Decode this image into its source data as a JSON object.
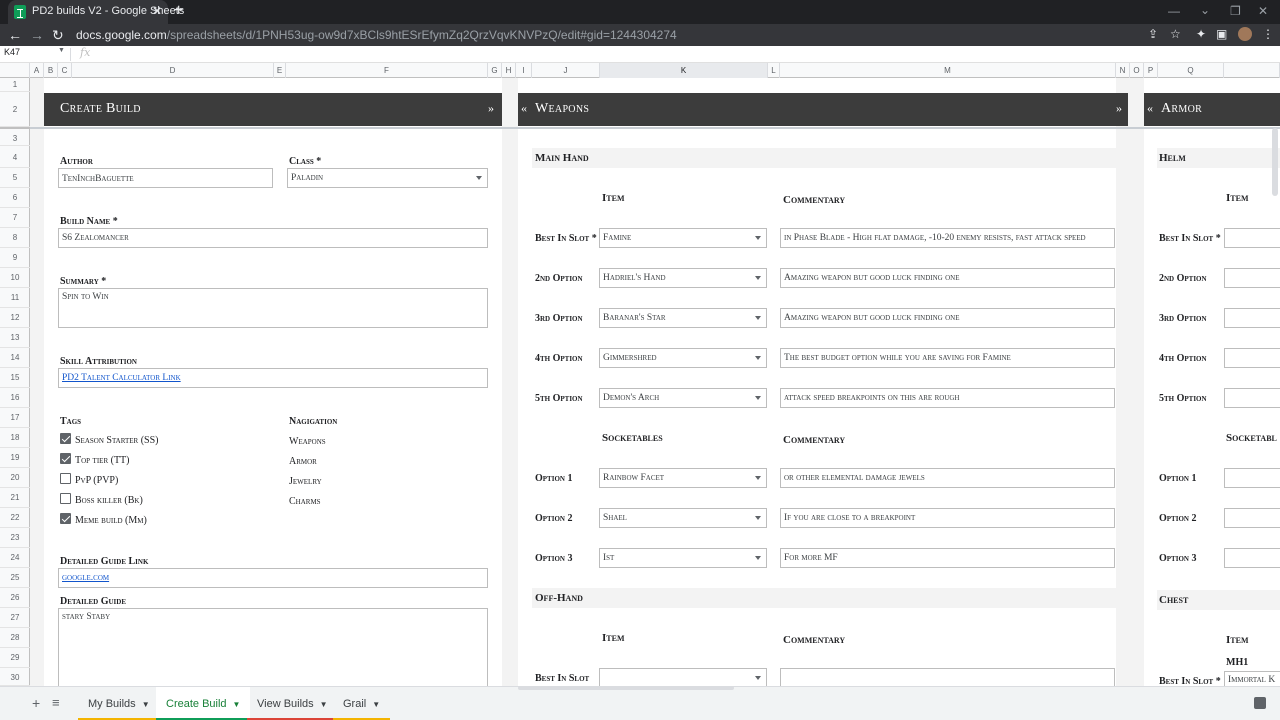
{
  "browser": {
    "tab_title": "PD2 builds V2 - Google Sheets",
    "url_host": "docs.google.com",
    "url_path": "/spreadsheets/d/1PNH53ug-ow9d7xBCls9htESrEfymZq2QrzVqvKNVPzQ/edit#gid=1244304274"
  },
  "sheet": {
    "cell_ref": "K47",
    "columns": [
      "A",
      "B",
      "C",
      "D",
      "E",
      "F",
      "G",
      "H",
      "I",
      "J",
      "K",
      "L",
      "M",
      "N",
      "O",
      "P",
      "Q"
    ],
    "rows": [
      "1",
      "2",
      "3",
      "4",
      "5",
      "6",
      "7",
      "8",
      "9",
      "10",
      "11",
      "12",
      "13",
      "14",
      "15",
      "16",
      "17",
      "18",
      "19",
      "20",
      "21",
      "22",
      "23",
      "24",
      "25",
      "26",
      "27",
      "28",
      "29",
      "30"
    ],
    "tabs": [
      {
        "label": "My Builds",
        "color": "#f4b400"
      },
      {
        "label": "Create Build",
        "color": "#0f9d58"
      },
      {
        "label": "View Builds",
        "color": "#db4437"
      },
      {
        "label": "Grail",
        "color": "#f4b400"
      }
    ]
  },
  "create": {
    "title": "Create Build",
    "arrow": "»",
    "author_label": "Author",
    "author_value": "TenInchBaguette",
    "class_label": "Class *",
    "class_value": "Paladin",
    "build_name_label": "Build Name *",
    "build_name_value": "S6 Zealomancer",
    "summary_label": "Summary *",
    "summary_value": "Spin to Win",
    "skill_label": "Skill Attribution",
    "skill_value": "PD2 Talent Calculator Link",
    "tags_label": "Tags",
    "tags": [
      {
        "label": "Season Starter (SS)",
        "checked": true
      },
      {
        "label": "Top tier (TT)",
        "checked": true
      },
      {
        "label": "PvP (PVP)",
        "checked": false
      },
      {
        "label": "Boss killer (Bk)",
        "checked": false
      },
      {
        "label": "Meme build (Mm)",
        "checked": true
      }
    ],
    "nav_label": "Nagigation",
    "nav": [
      "Weapons",
      "Armor",
      "Jewelry",
      "Charms"
    ],
    "guide_link_label": "Detailed Guide Link",
    "guide_link_value": "google.com",
    "guide_label": "Detailed Guide",
    "guide_value": "stary Staby"
  },
  "weapons": {
    "title": "Weapons",
    "left_arrow": "«",
    "right_arrow": "»",
    "main_hand": "Main Hand",
    "item_head": "Item",
    "commentary_head": "Commentary",
    "socketables_head": "Socketables",
    "rows": [
      {
        "label": "Best In Slot *",
        "item": "Famine",
        "comment": "in Phase Blade  - High flat damage, -10-20 enemy resists, fast attack speed"
      },
      {
        "label": "2nd Option",
        "item": "Hadriel's Hand",
        "comment": "Amazing weapon but good luck finding one"
      },
      {
        "label": "3rd Option",
        "item": "Baranar's Star",
        "comment": "Amazing weapon but good luck finding one"
      },
      {
        "label": "4th Option",
        "item": "Gimmershred",
        "comment": "The best budget option while you are saving for Famine"
      },
      {
        "label": "5th Option",
        "item": "Demon's Arch",
        "comment": "attack speed breakpoints on this are rough"
      }
    ],
    "sockets": [
      {
        "label": "Option 1",
        "item": "Rainbow Facet",
        "comment": "or other elemental damage jewels"
      },
      {
        "label": "Option 2",
        "item": "Shael",
        "comment": "If you are close to a breakpoint"
      },
      {
        "label": "Option 3",
        "item": "Ist",
        "comment": "For more MF"
      }
    ],
    "off_hand": "Off-Hand",
    "off_item_head": "Item",
    "off_commentary_head": "Commentary",
    "off_row_label": "Best In Slot"
  },
  "armor": {
    "title": "Armor",
    "left_arrow": "«",
    "helm": "Helm",
    "item_head": "Item",
    "labels": [
      "Best In Slot *",
      "2nd Option",
      "3rd Option",
      "4th Option",
      "5th Option"
    ],
    "socketables_head": "Socketabl",
    "sock_labels": [
      "Option 1",
      "Option 2",
      "Option 3"
    ],
    "chest": "Chest",
    "chest_item_head": "Item",
    "chest_row_label": "Best In Slot *",
    "chest_note": "MH1",
    "chest_value": "Immortal K"
  }
}
